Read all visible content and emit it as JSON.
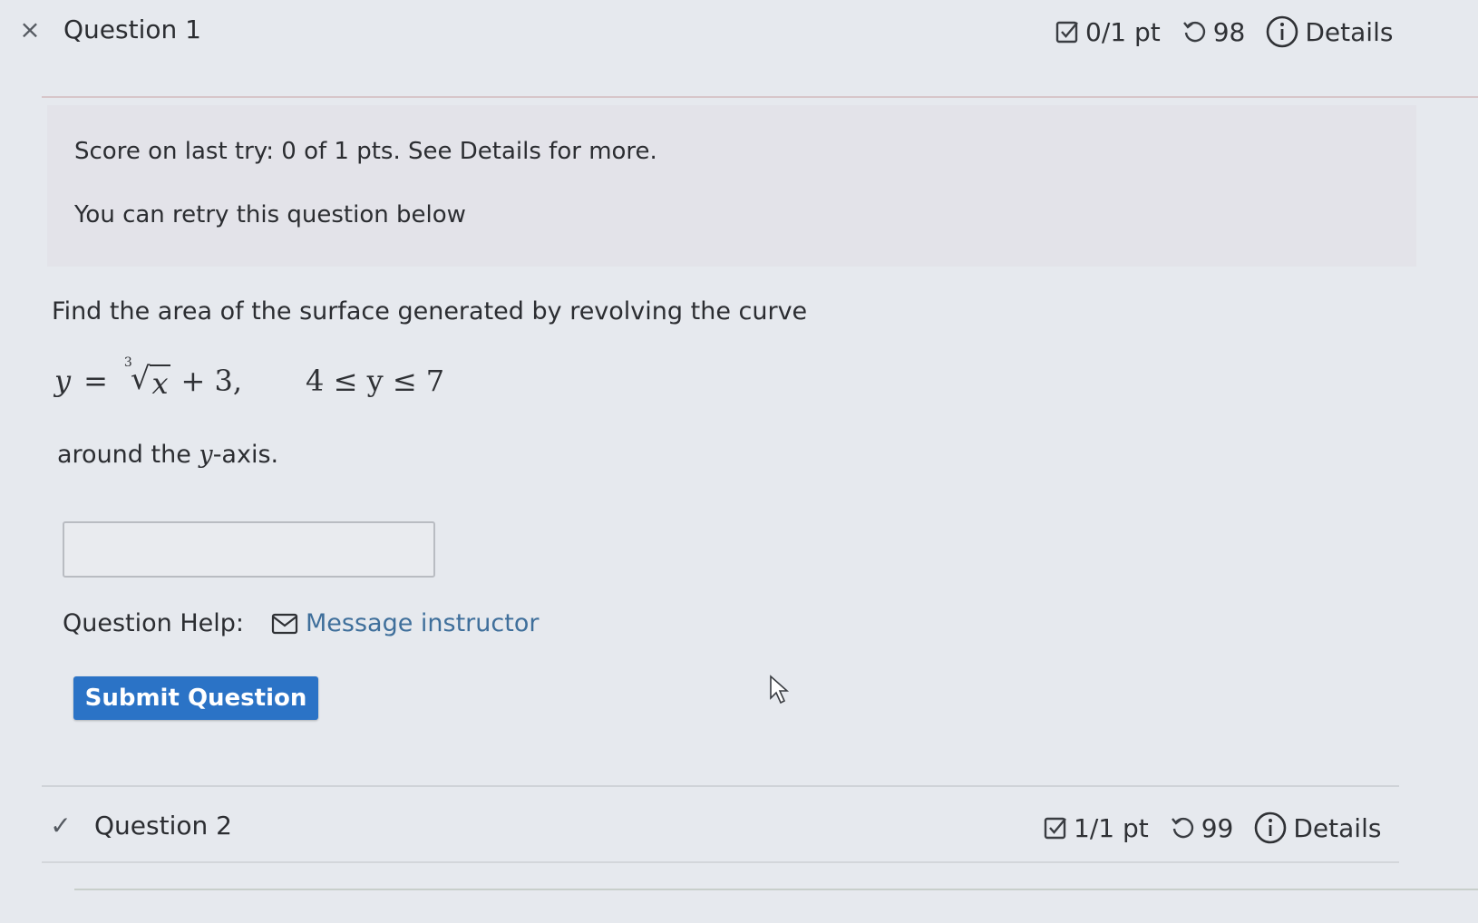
{
  "question1": {
    "close_symbol": "×",
    "title": "Question 1",
    "points": "0/1 pt",
    "attempts": "98",
    "details_label": "Details"
  },
  "score_panel": {
    "line1": "Score on last try: 0 of 1 pts. See Details for more.",
    "line2": "You can retry this question below"
  },
  "problem": {
    "prompt": "Find the area of the surface generated by revolving the curve",
    "eq_y": "y",
    "eq_equals": "=",
    "root_index": "3",
    "root_symbol": "√",
    "radicand": "x",
    "eq_rest": "+ 3,",
    "constraint": "4 ≤ y ≤ 7",
    "around_prefix": "around the ",
    "around_var": "y",
    "around_suffix": "-axis."
  },
  "answer": {
    "value": "",
    "placeholder": ""
  },
  "help": {
    "label": "Question Help:",
    "message_link": "Message instructor"
  },
  "submit_label": "Submit Question",
  "question2": {
    "check_symbol": "✓",
    "title": "Question 2",
    "points": "1/1 pt",
    "attempts": "99",
    "details_label": "Details"
  },
  "colors": {
    "accent": "#2b73c6",
    "link": "#3f6f9b",
    "background": "#e6e9ee"
  },
  "icons": {
    "close": "close-icon",
    "checkbox": "checkbox-icon",
    "retry": "retry-icon",
    "info": "info-icon",
    "envelope": "envelope-icon",
    "check": "check-icon",
    "cursor": "mouse-pointer-icon"
  }
}
